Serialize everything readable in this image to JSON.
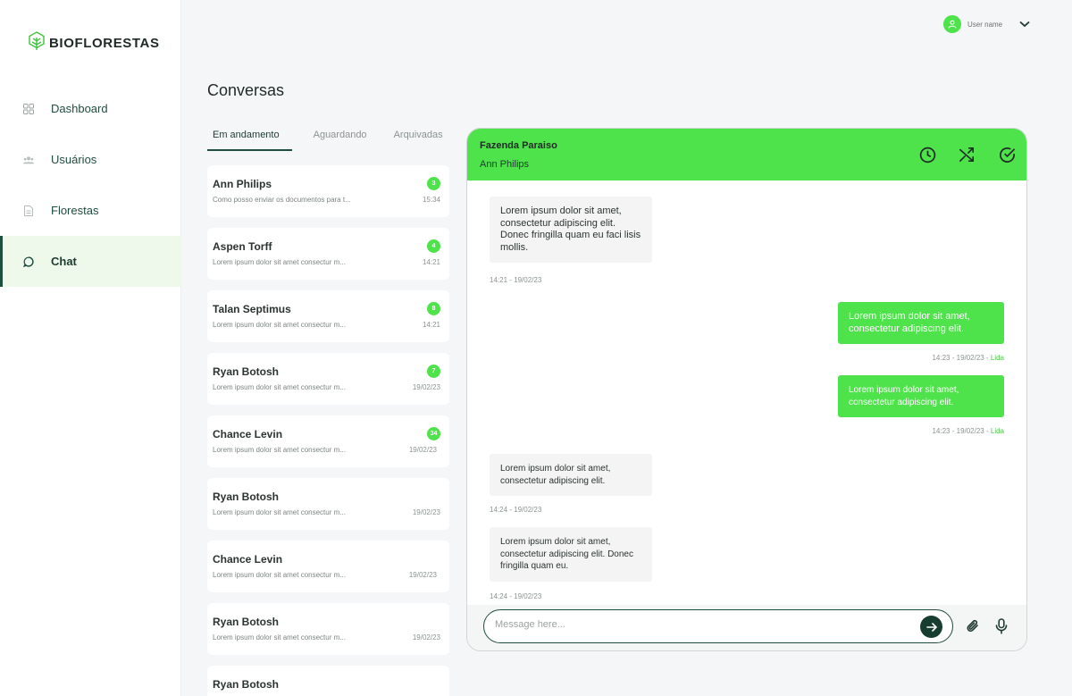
{
  "brand": {
    "name": "BIOFLORESTAS"
  },
  "user": {
    "name": "User name"
  },
  "sidebar": {
    "items": [
      {
        "label": "Dashboard",
        "icon": "grid-icon"
      },
      {
        "label": "Usuários",
        "icon": "users-icon"
      },
      {
        "label": "Florestas",
        "icon": "document-icon"
      },
      {
        "label": "Chat",
        "icon": "chat-icon",
        "active": true
      }
    ]
  },
  "page": {
    "title": "Conversas"
  },
  "tabs": [
    {
      "label": "Em andamento",
      "active": true
    },
    {
      "label": "Aguardando"
    },
    {
      "label": "Arquivadas"
    }
  ],
  "conversations": [
    {
      "name": "Ann Philips",
      "preview": "Como posso enviar os documentos para t...",
      "badge": "3",
      "time": "15:34"
    },
    {
      "name": "Aspen Torff",
      "preview": "Lorem ipsum dolor sit amet consectur m...",
      "badge": "4",
      "time": "14:21"
    },
    {
      "name": "Talan Septimus",
      "preview": "Lorem ipsum dolor sit amet consectur m...",
      "badge": "8",
      "time": "14:21"
    },
    {
      "name": "Ryan Botosh",
      "preview": "Lorem ipsum dolor sit amet consectur m...",
      "badge": "7",
      "time": "19/02/23"
    },
    {
      "name": "Chance Levin",
      "preview": "Lorem ipsum dolor sit amet consectur m...",
      "badge": "34",
      "time": "19/02/23"
    },
    {
      "name": "Ryan Botosh",
      "preview": "Lorem ipsum dolor sit amet consectur m...",
      "badge": "",
      "time": "19/02/23"
    },
    {
      "name": "Chance Levin",
      "preview": "Lorem ipsum dolor sit amet consectur m...",
      "badge": "",
      "time": "19/02/23"
    },
    {
      "name": "Ryan Botosh",
      "preview": "Lorem ipsum dolor sit amet consectur m...",
      "badge": "",
      "time": "19/02/23"
    },
    {
      "name": "Ryan Botosh",
      "preview": "",
      "badge": "",
      "time": ""
    }
  ],
  "chat": {
    "title": "Fazenda Paraiso",
    "subtitle": "Ann Philips",
    "header_icons": [
      "clock-icon",
      "shuffle-icon",
      "check-circle-icon"
    ],
    "messages": [
      {
        "dir": "in",
        "text": "Lorem ipsum dolor sit amet, consectetur adipiscing elit. Donec fringilla quam eu faci lisis mollis.",
        "meta": "14:21 - 19/02/23",
        "status": ""
      },
      {
        "dir": "out",
        "text": "Lorem ipsum dolor sit amet, consectetur adipiscing elit.",
        "meta": "14:23 - 19/02/23 - ",
        "status": "Lida"
      },
      {
        "dir": "out",
        "text": "Lorem ipsum dolor sit amet, consectetur adipiscing elit.",
        "meta": "14:23 - 19/02/23 - ",
        "status": "Lida"
      },
      {
        "dir": "in",
        "text": "Lorem ipsum dolor sit amet, consectetur adipiscing elit.",
        "meta": "14:24 - 19/02/23",
        "status": ""
      },
      {
        "dir": "in",
        "text": "Lorem ipsum dolor sit amet, consectetur adipiscing elit. Donec fringilla quam eu.",
        "meta": "14:24 - 19/02/23",
        "status": ""
      }
    ],
    "composer": {
      "placeholder": "Message here..."
    }
  },
  "colors": {
    "accent": "#4ee24b",
    "dark": "#173d31",
    "background": "#f5f6f8"
  }
}
